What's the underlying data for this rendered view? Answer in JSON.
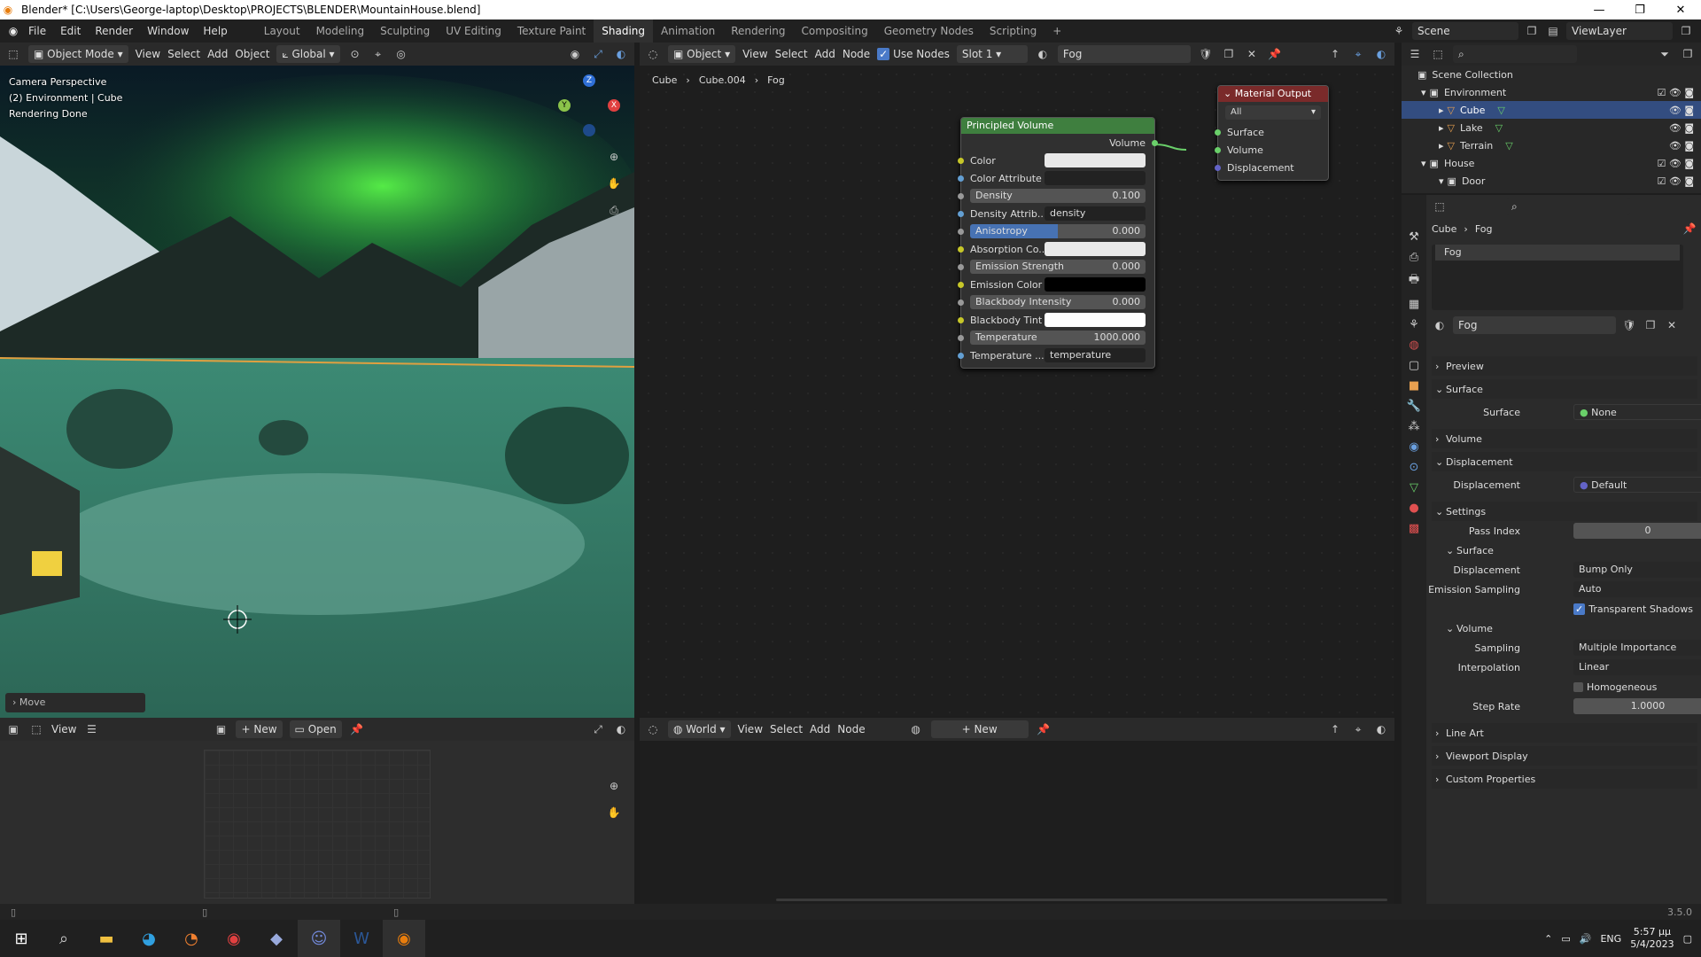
{
  "window": {
    "title": "Blender* [C:\\Users\\George-laptop\\Desktop\\PROJECTS\\BLENDER\\MountainHouse.blend]"
  },
  "menu": [
    "File",
    "Edit",
    "Render",
    "Window",
    "Help"
  ],
  "workspaces": [
    "Layout",
    "Modeling",
    "Sculpting",
    "UV Editing",
    "Texture Paint",
    "Shading",
    "Animation",
    "Rendering",
    "Compositing",
    "Geometry Nodes",
    "Scripting"
  ],
  "active_workspace": "Shading",
  "scene": "Scene",
  "view_layer": "ViewLayer",
  "viewport": {
    "mode": "Object Mode",
    "menu": [
      "View",
      "Select",
      "Add",
      "Object"
    ],
    "orientation": "Global",
    "overlay_lines": [
      "Camera Perspective",
      "(2) Environment | Cube",
      "Rendering Done"
    ],
    "last_op": "Move",
    "gizmo": {
      "z": "Z",
      "y": "Y",
      "x": "X"
    }
  },
  "node_editor": {
    "type": "Object",
    "menu": [
      "View",
      "Select",
      "Add",
      "Node"
    ],
    "use_nodes": "Use Nodes",
    "slot": "Slot 1",
    "material": "Fog",
    "breadcrumb": [
      "Cube",
      "Cube.004",
      "Fog"
    ],
    "principled": {
      "title": "Principled Volume",
      "output": "Volume",
      "rows": [
        {
          "label": "Color",
          "value": ""
        },
        {
          "label": "Color Attribute",
          "value": ""
        },
        {
          "label": "Density",
          "value": "0.100"
        },
        {
          "label": "Density Attrib...",
          "value": "density"
        },
        {
          "label": "Anisotropy",
          "value": "0.000"
        },
        {
          "label": "Absorption Co...",
          "value": ""
        },
        {
          "label": "Emission Strength",
          "value": "0.000"
        },
        {
          "label": "Emission Color",
          "value": ""
        },
        {
          "label": "Blackbody Intensity",
          "value": "0.000"
        },
        {
          "label": "Blackbody Tint",
          "value": ""
        },
        {
          "label": "Temperature",
          "value": "1000.000"
        },
        {
          "label": "Temperature ...",
          "value": "temperature"
        }
      ]
    },
    "output_node": {
      "title": "Material Output",
      "target": "All",
      "inputs": [
        "Surface",
        "Volume",
        "Displacement"
      ]
    }
  },
  "outliner": {
    "root": "Scene Collection",
    "items": [
      {
        "name": "Environment",
        "level": 1
      },
      {
        "name": "Cube",
        "level": 2
      },
      {
        "name": "Lake",
        "level": 2
      },
      {
        "name": "Terrain",
        "level": 2
      },
      {
        "name": "House",
        "level": 1
      },
      {
        "name": "Door",
        "level": 2
      }
    ]
  },
  "properties": {
    "breadcrumb": [
      "Cube",
      "Fog"
    ],
    "slot": "Fog",
    "material": "Fog",
    "sections": {
      "preview": "Preview",
      "surface": "Surface",
      "volume": "Volume",
      "displacement": "Displacement",
      "settings": "Settings",
      "line_art": "Line Art",
      "viewport_display": "Viewport Display",
      "custom_props": "Custom Properties"
    },
    "surface_label": "Surface",
    "surface_value": "None",
    "displacement_label": "Displacement",
    "displacement_value": "Default",
    "pass_index_label": "Pass Index",
    "pass_index": "0",
    "sub_surface": "Surface",
    "disp_method_label": "Displacement",
    "disp_method": "Bump Only",
    "emission_label": "Emission Sampling",
    "emission": "Auto",
    "transparent_shadows": "Transparent Shadows",
    "sub_volume": "Volume",
    "sampling_label": "Sampling",
    "sampling": "Multiple Importance",
    "interp_label": "Interpolation",
    "interp": "Linear",
    "homogeneous": "Homogeneous",
    "step_label": "Step Rate",
    "step": "1.0000"
  },
  "image_editor": {
    "view": "View",
    "new": "New",
    "open": "Open"
  },
  "world_editor": {
    "type": "World",
    "menu": [
      "View",
      "Select",
      "Add",
      "Node"
    ],
    "new": "New"
  },
  "status": {
    "version": "3.5.0"
  },
  "taskbar": {
    "lang": "ENG",
    "time": "5:57 μμ",
    "date": "5/4/2023"
  }
}
